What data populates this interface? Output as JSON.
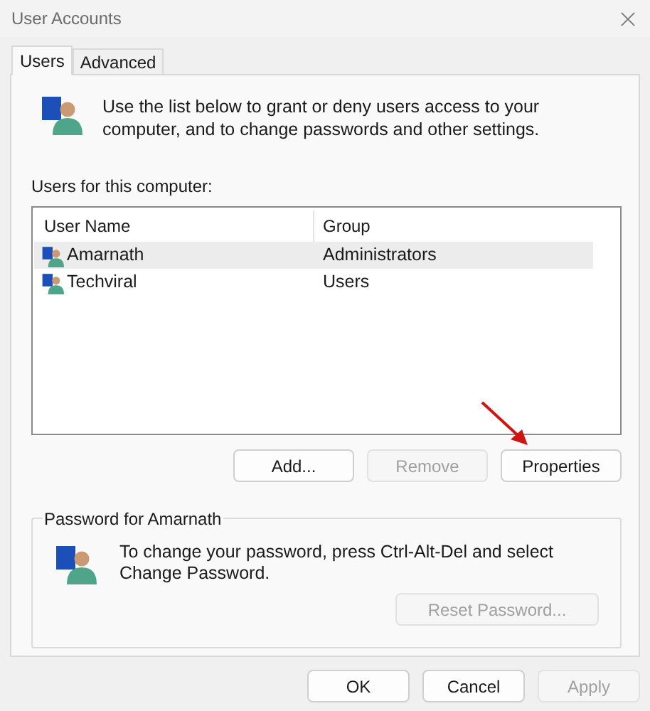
{
  "window": {
    "title": "User Accounts"
  },
  "tabs": [
    {
      "label": "Users",
      "selected": true
    },
    {
      "label": "Advanced",
      "selected": false
    }
  ],
  "intro": "Use the list below to grant or deny users access to your computer, and to change passwords and other settings.",
  "users_label": "Users for this computer:",
  "table": {
    "columns": [
      "User Name",
      "Group"
    ],
    "rows": [
      {
        "name": "Amarnath",
        "group": "Administrators",
        "selected": true
      },
      {
        "name": "Techviral",
        "group": "Users",
        "selected": false
      }
    ]
  },
  "list_buttons": [
    {
      "label": "Add...",
      "disabled": false
    },
    {
      "label": "Remove",
      "disabled": true
    },
    {
      "label": "Properties",
      "disabled": false
    }
  ],
  "password_group": {
    "title": "Password for Amarnath",
    "text": "To change your password, press Ctrl-Alt-Del and select Change Password.",
    "button": {
      "label": "Reset Password...",
      "disabled": true
    }
  },
  "dialog_buttons": [
    {
      "label": "OK",
      "disabled": false
    },
    {
      "label": "Cancel",
      "disabled": false
    },
    {
      "label": "Apply",
      "disabled": true
    }
  ]
}
